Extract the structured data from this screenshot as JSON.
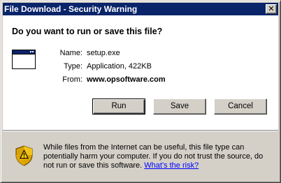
{
  "window": {
    "title": "File Download - Security Warning",
    "close_glyph": "✕"
  },
  "question": "Do you want to run or save this file?",
  "file_info": {
    "name_label": "Name:",
    "name_value": "setup.exe",
    "type_label": "Type:",
    "type_value": "Application, 422KB",
    "from_label": "From:",
    "from_value": "www.opsoftware.com"
  },
  "buttons": {
    "run": "Run",
    "save": "Save",
    "cancel": "Cancel"
  },
  "warning": {
    "text": "While files from the Internet can be useful, this file type can potentially harm your computer. If you do not trust the source, do not run or save this software.",
    "link": "What's the risk?"
  },
  "icons": {
    "file": "application-window-icon",
    "warning": "security-shield-warning-icon"
  },
  "colors": {
    "titlebar": "#0a246a",
    "dialog_face": "#d4d0c8",
    "link": "#0000ff"
  }
}
